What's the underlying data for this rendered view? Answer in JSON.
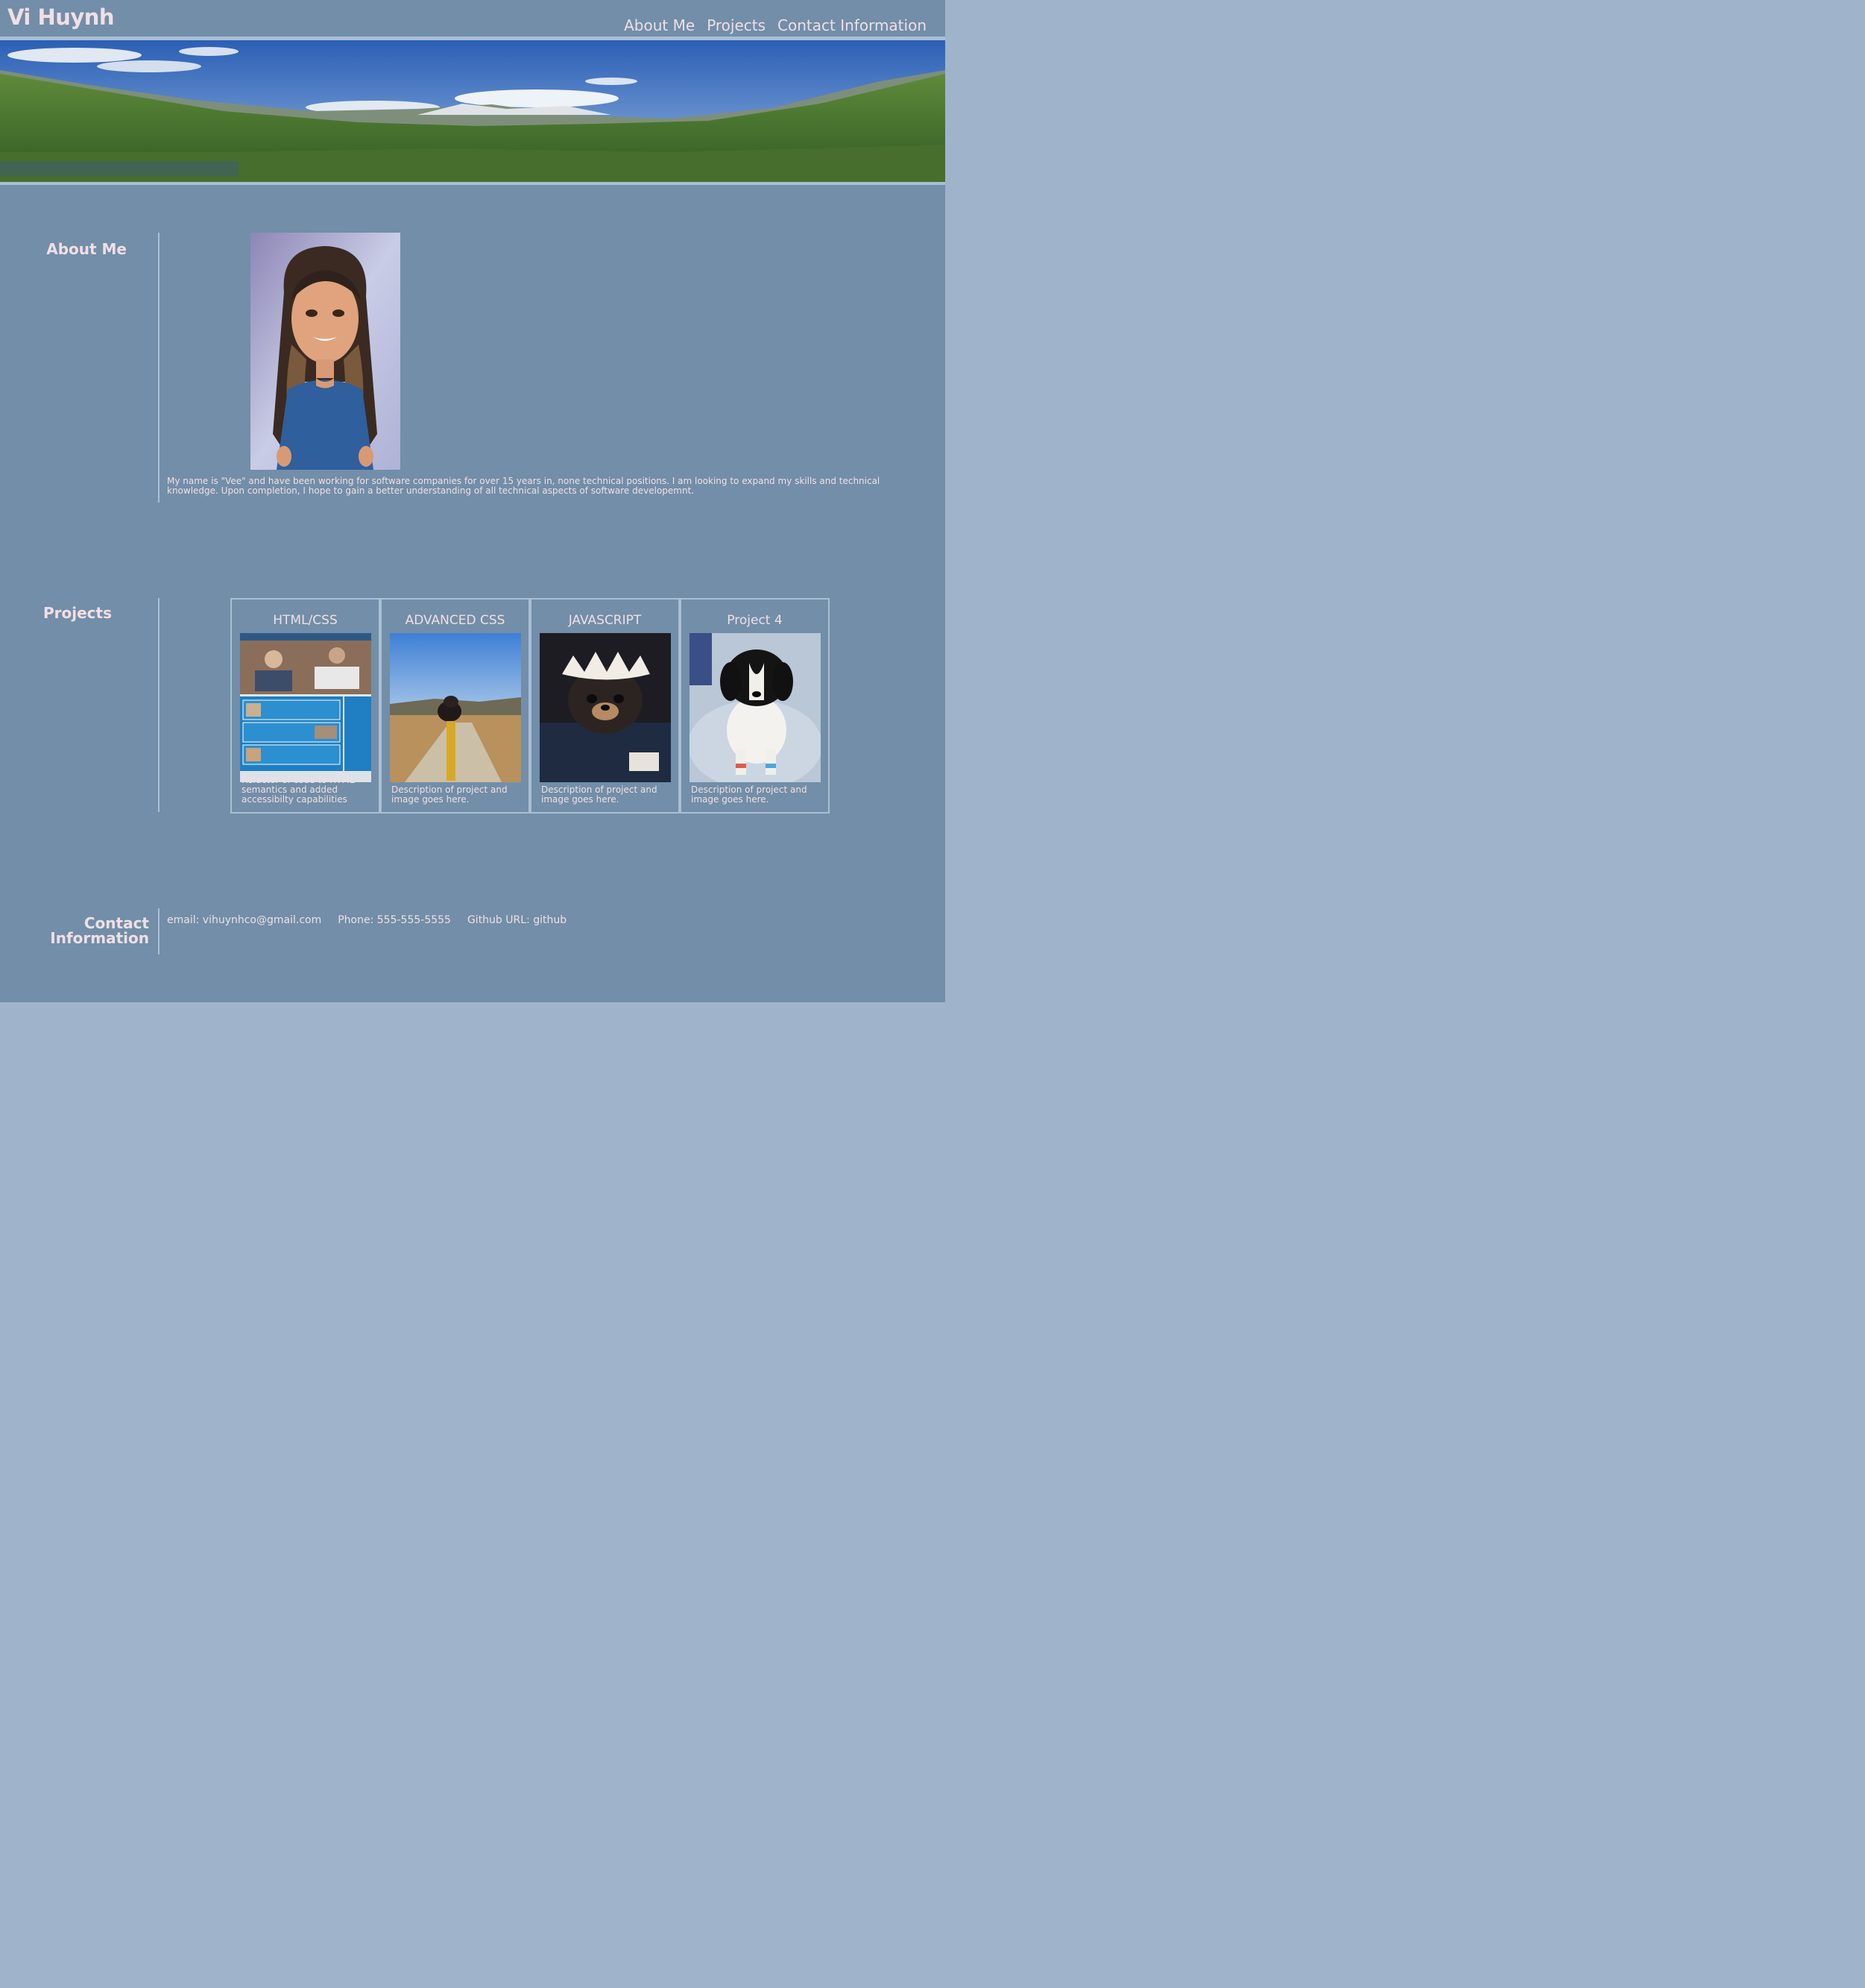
{
  "header": {
    "title": "Vi Huynh",
    "nav": [
      "About Me",
      "Projects",
      "Contact Information"
    ]
  },
  "hero": {
    "description": "mountain landscape banner"
  },
  "about": {
    "label": "About Me",
    "text": "My name is \"Vee\" and have been working for software companies for over 15 years in, none technical positions. I am looking to expand my skills and technical knowledge. Upon completion, I hope to gain a better understanding of all technical aspects of software developemnt."
  },
  "projects": {
    "label": "Projects",
    "cards": [
      {
        "title": "HTML/CSS",
        "desc": "Refactor of code to HTML semantics and added accessibilty capabilities"
      },
      {
        "title": "ADVANCED CSS",
        "desc": "Description of project and image goes here."
      },
      {
        "title": "JAVASCRIPT",
        "desc": "Description of project and image goes here."
      },
      {
        "title": "Project 4",
        "desc": "Description of project and image goes here."
      }
    ]
  },
  "contact": {
    "label_line1": "Contact",
    "label_line2": "Information",
    "email": "email: vihuynhco@gmail.com",
    "phone": "Phone: 555-555-5555",
    "github": "Github URL: github"
  },
  "colors": {
    "page_bg": "#9fb3cb",
    "content_bg": "#728ea8",
    "text": "#f1dfe4",
    "accent_border": "#a9bfd4"
  }
}
